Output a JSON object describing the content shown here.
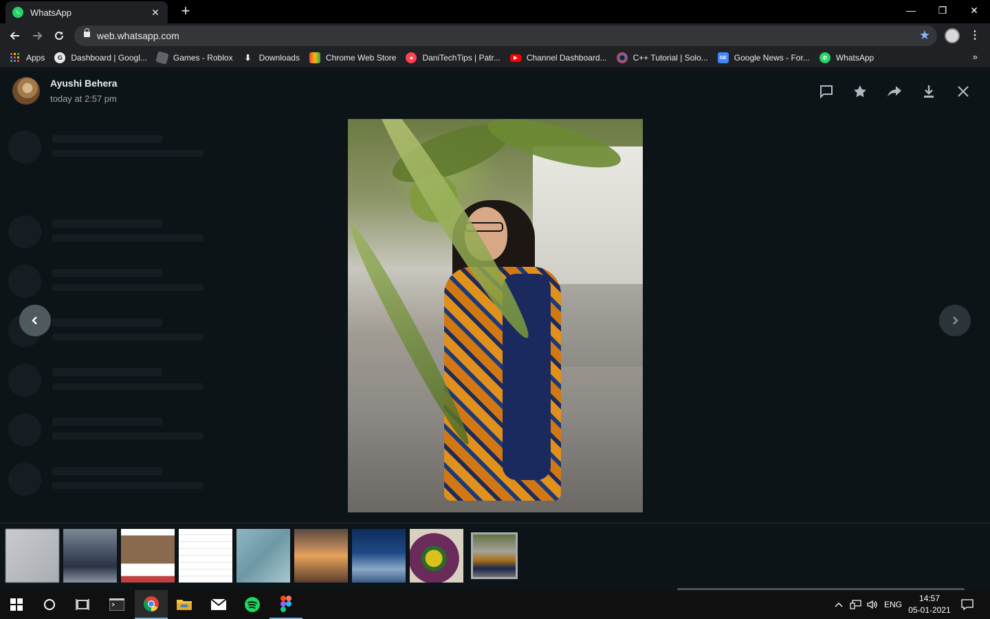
{
  "browser": {
    "tab_title": "WhatsApp",
    "tab_close": "✕",
    "new_tab": "+",
    "url": "web.whatsapp.com",
    "window_controls": [
      "—",
      "❐",
      "✕"
    ]
  },
  "bookmarks": [
    {
      "label": "Apps",
      "icon": "apps-grid-icon",
      "color": "#ea4335"
    },
    {
      "label": "Dashboard | Googl...",
      "icon": "google-dashboard-icon",
      "color": "#5f6368"
    },
    {
      "label": "Games - Roblox",
      "icon": "roblox-icon",
      "color": "#7a7a7a"
    },
    {
      "label": "Downloads",
      "icon": "download-icon",
      "color": "#202124"
    },
    {
      "label": "Chrome Web Store",
      "icon": "chrome-web-store-icon",
      "color": "#e94335"
    },
    {
      "label": "DaniTechTips | Patr...",
      "icon": "patreon-icon",
      "color": "#ff424d"
    },
    {
      "label": "Channel Dashboard...",
      "icon": "youtube-icon",
      "color": "#ff0000"
    },
    {
      "label": "C++ Tutorial | Solo...",
      "icon": "sololearn-icon",
      "color": "#2f6fde"
    },
    {
      "label": "Google News - For...",
      "icon": "google-news-icon",
      "color": "#4285f4"
    },
    {
      "label": "WhatsApp",
      "icon": "whatsapp-icon",
      "color": "#25d366"
    }
  ],
  "bookmarks_more": "»",
  "viewer": {
    "sender_name": "Ayushi Behera",
    "sent_time": "today at 2:57 pm",
    "actions": [
      "reply-icon",
      "star-icon",
      "forward-icon",
      "download-icon",
      "close-icon"
    ],
    "thumbnail_count": 9,
    "active_thumbnail_index": 8
  },
  "taskbar": {
    "apps": [
      "start",
      "search",
      "task-view",
      "terminal",
      "chrome",
      "file-explorer",
      "mail",
      "spotify",
      "figma"
    ],
    "language": "ENG",
    "clock_time": "14:57",
    "clock_date": "05-01-2021"
  },
  "colors": {
    "whatsapp_green": "#25d366",
    "viewer_bg": "#0d1418",
    "chrome_dark": "#202124",
    "accent_blue": "#8ab4f8"
  }
}
